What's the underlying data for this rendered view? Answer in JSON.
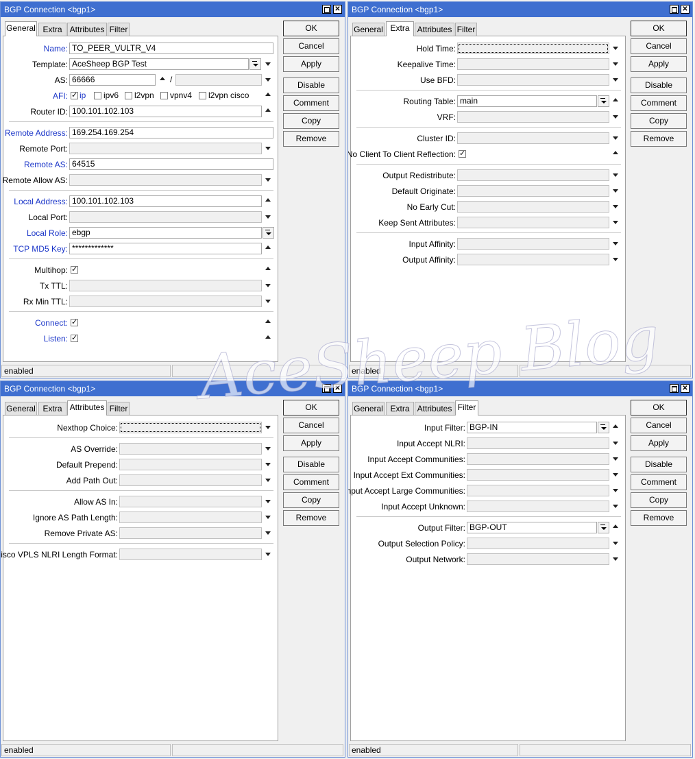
{
  "windows": [
    {
      "title": "BGP Connection <bgp1>",
      "tabs": [
        "General",
        "Extra",
        "Attributes",
        "Filter"
      ],
      "active_tab": "General",
      "buttons": [
        "OK",
        "Cancel",
        "Apply",
        "Disable",
        "Comment",
        "Copy",
        "Remove"
      ],
      "status": "enabled",
      "fields": {
        "name": {
          "label": "Name:",
          "value": "TO_PEER_VULTR_V4"
        },
        "template": {
          "label": "Template:",
          "value": "AceSheep BGP Test"
        },
        "as": {
          "label": "AS:",
          "value": "66666",
          "sep": "/"
        },
        "afi": {
          "label": "AFI:",
          "options": [
            {
              "label": "ip",
              "checked": true
            },
            {
              "label": "ipv6",
              "checked": false
            },
            {
              "label": "l2vpn",
              "checked": false
            },
            {
              "label": "vpnv4",
              "checked": false
            },
            {
              "label": "l2vpn cisco",
              "checked": false
            }
          ]
        },
        "router_id": {
          "label": "Router ID:",
          "value": "100.101.102.103"
        },
        "remote_address": {
          "label": "Remote Address:",
          "value": "169.254.169.254"
        },
        "remote_port": {
          "label": "Remote Port:",
          "value": ""
        },
        "remote_as": {
          "label": "Remote AS:",
          "value": "64515"
        },
        "remote_allow_as": {
          "label": "Remote Allow AS:",
          "value": ""
        },
        "local_address": {
          "label": "Local Address:",
          "value": "100.101.102.103"
        },
        "local_port": {
          "label": "Local Port:",
          "value": ""
        },
        "local_role": {
          "label": "Local Role:",
          "value": "ebgp"
        },
        "tcp_md5_key": {
          "label": "TCP MD5 Key:",
          "value": "*************"
        },
        "multihop": {
          "label": "Multihop:",
          "checked": true
        },
        "tx_ttl": {
          "label": "Tx TTL:",
          "value": ""
        },
        "rx_min_ttl": {
          "label": "Rx Min TTL:",
          "value": ""
        },
        "connect": {
          "label": "Connect:",
          "checked": true
        },
        "listen": {
          "label": "Listen:",
          "checked": true
        }
      }
    },
    {
      "title": "BGP Connection <bgp1>",
      "tabs": [
        "General",
        "Extra",
        "Attributes",
        "Filter"
      ],
      "active_tab": "Extra",
      "buttons": [
        "OK",
        "Cancel",
        "Apply",
        "Disable",
        "Comment",
        "Copy",
        "Remove"
      ],
      "status": "enabled",
      "fields": {
        "hold_time": {
          "label": "Hold Time:",
          "value": ""
        },
        "keepalive_time": {
          "label": "Keepalive Time:",
          "value": ""
        },
        "use_bfd": {
          "label": "Use BFD:",
          "value": ""
        },
        "routing_table": {
          "label": "Routing Table:",
          "value": "main"
        },
        "vrf": {
          "label": "VRF:",
          "value": ""
        },
        "cluster_id": {
          "label": "Cluster ID:",
          "value": ""
        },
        "no_client_reflection": {
          "label": "No Client To Client Reflection:",
          "checked": true
        },
        "output_redistribute": {
          "label": "Output Redistribute:",
          "value": ""
        },
        "default_originate": {
          "label": "Default Originate:",
          "value": ""
        },
        "no_early_cut": {
          "label": "No Early Cut:",
          "value": ""
        },
        "keep_sent_attributes": {
          "label": "Keep Sent Attributes:",
          "value": ""
        },
        "input_affinity": {
          "label": "Input Affinity:",
          "value": ""
        },
        "output_affinity": {
          "label": "Output Affinity:",
          "value": ""
        }
      }
    },
    {
      "title": "BGP Connection <bgp1>",
      "tabs": [
        "General",
        "Extra",
        "Attributes",
        "Filter"
      ],
      "active_tab": "Attributes",
      "buttons": [
        "OK",
        "Cancel",
        "Apply",
        "Disable",
        "Comment",
        "Copy",
        "Remove"
      ],
      "status": "enabled",
      "fields": {
        "nexthop_choice": {
          "label": "Nexthop Choice:",
          "value": ""
        },
        "as_override": {
          "label": "AS Override:",
          "value": ""
        },
        "default_prepend": {
          "label": "Default Prepend:",
          "value": ""
        },
        "add_path_out": {
          "label": "Add Path Out:",
          "value": ""
        },
        "allow_as_in": {
          "label": "Allow AS In:",
          "value": ""
        },
        "ignore_as_path_length": {
          "label": "Ignore AS Path Length:",
          "value": ""
        },
        "remove_private_as": {
          "label": "Remove Private AS:",
          "value": ""
        },
        "cisco_vpls": {
          "label": "Cisco VPLS NLRI Length Format:",
          "value": ""
        }
      }
    },
    {
      "title": "BGP Connection <bgp1>",
      "tabs": [
        "General",
        "Extra",
        "Attributes",
        "Filter"
      ],
      "active_tab": "Filter",
      "buttons": [
        "OK",
        "Cancel",
        "Apply",
        "Disable",
        "Comment",
        "Copy",
        "Remove"
      ],
      "status": "enabled",
      "fields": {
        "input_filter": {
          "label": "Input Filter:",
          "value": "BGP-IN"
        },
        "input_accept_nlri": {
          "label": "Input Accept NLRI:",
          "value": ""
        },
        "input_accept_communities": {
          "label": "Input Accept Communities:",
          "value": ""
        },
        "input_accept_ext_communities": {
          "label": "Input Accept Ext Communities:",
          "value": ""
        },
        "input_accept_large_communities": {
          "label": "Input Accept Large Communities:",
          "value": ""
        },
        "input_accept_unknown": {
          "label": "Input Accept Unknown:",
          "value": ""
        },
        "output_filter": {
          "label": "Output Filter:",
          "value": "BGP-OUT"
        },
        "output_selection_policy": {
          "label": "Output Selection Policy:",
          "value": ""
        },
        "output_network": {
          "label": "Output Network:",
          "value": ""
        }
      }
    }
  ],
  "watermark": "AceSheep Blog"
}
